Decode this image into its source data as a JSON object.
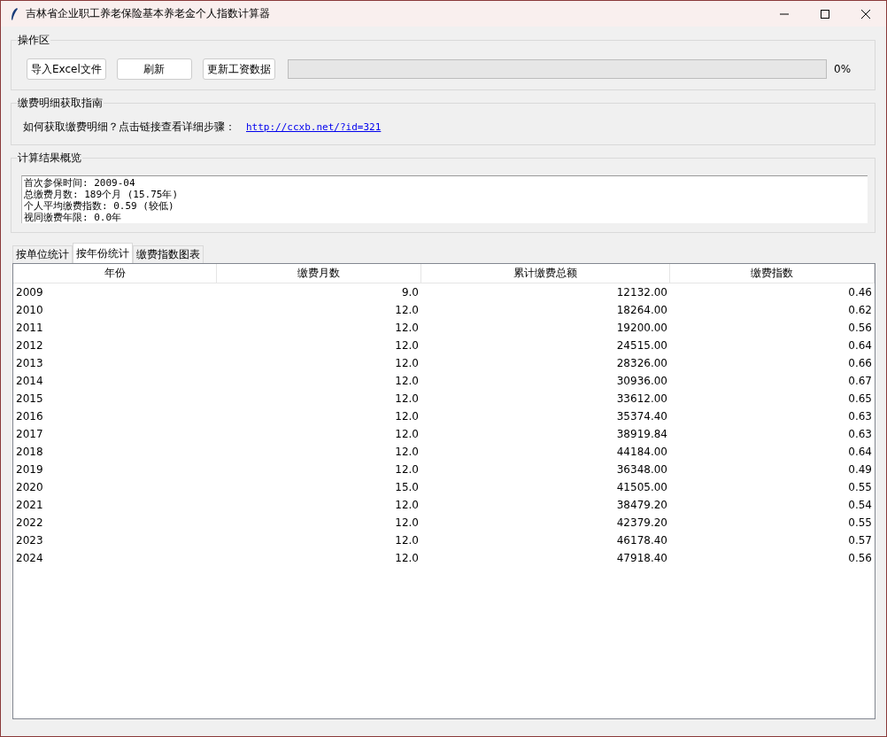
{
  "window": {
    "title": "吉林省企业职工养老保险基本养老金个人指数计算器"
  },
  "operations": {
    "title": "操作区",
    "buttons": [
      "导入Excel文件",
      "刷新",
      "更新工资数据"
    ],
    "progress": {
      "level": 0,
      "reading": "0%"
    }
  },
  "guide": {
    "title": "缴费明细获取指南",
    "text": "如何获取缴费明细？点击链接查看详细步骤：",
    "link": "http://ccxb.net/?id=321"
  },
  "summary": {
    "title": "计算结果概览",
    "lines": [
      "首次参保时间: 2009-04",
      "总缴费月数: 189个月 (15.75年)",
      "个人平均缴费指数: 0.59 (较低)",
      "视同缴费年限: 0.0年"
    ]
  },
  "tabs": [
    {
      "label": "按单位统计",
      "selected": false
    },
    {
      "label": "按年份统计",
      "selected": true
    },
    {
      "label": "缴费指数图表",
      "selected": false
    }
  ],
  "table": {
    "columns": [
      "年份",
      "缴费月数",
      "累计缴费总额",
      "缴费指数"
    ],
    "rows": [
      [
        "2009",
        "9.0",
        "12132.00",
        "0.46"
      ],
      [
        "2010",
        "12.0",
        "18264.00",
        "0.62"
      ],
      [
        "2011",
        "12.0",
        "19200.00",
        "0.56"
      ],
      [
        "2012",
        "12.0",
        "24515.00",
        "0.64"
      ],
      [
        "2013",
        "12.0",
        "28326.00",
        "0.66"
      ],
      [
        "2014",
        "12.0",
        "30936.00",
        "0.67"
      ],
      [
        "2015",
        "12.0",
        "33612.00",
        "0.65"
      ],
      [
        "2016",
        "12.0",
        "35374.40",
        "0.63"
      ],
      [
        "2017",
        "12.0",
        "38919.84",
        "0.63"
      ],
      [
        "2018",
        "12.0",
        "44184.00",
        "0.64"
      ],
      [
        "2019",
        "12.0",
        "36348.00",
        "0.49"
      ],
      [
        "2020",
        "15.0",
        "41505.00",
        "0.55"
      ],
      [
        "2021",
        "12.0",
        "38479.20",
        "0.54"
      ],
      [
        "2022",
        "12.0",
        "42379.20",
        "0.55"
      ],
      [
        "2023",
        "12.0",
        "46178.40",
        "0.57"
      ],
      [
        "2024",
        "12.0",
        "47918.40",
        "0.56"
      ]
    ]
  }
}
